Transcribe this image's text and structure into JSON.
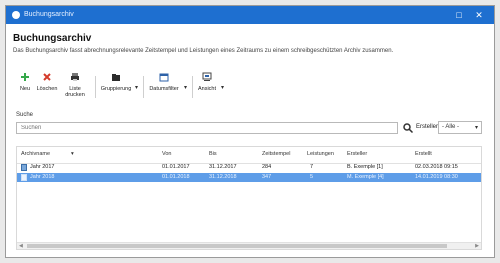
{
  "window": {
    "title": "Buchungsarchiv"
  },
  "header": {
    "title": "Buchungsarchiv",
    "description": "Das Buchungsarchiv fasst abrechnungsrelevante Zeitstempel und Leistungen eines Zeitraums zu einem schreibgeschützten Archiv zusammen."
  },
  "toolbar": {
    "new_label": "Neu",
    "delete_label": "Löschen",
    "print_label": "Liste drucken",
    "group_label": "Gruppierung",
    "datefilter_label": "Datumsfilter",
    "view_label": "Ansicht"
  },
  "search": {
    "label": "Suche",
    "placeholder": "Suchen",
    "filter_label": "Ersteller",
    "filter_value": "- Alle -"
  },
  "table": {
    "columns": [
      "Archivname",
      "Von",
      "Bis",
      "Zeitstempel",
      "Leistungen",
      "Ersteller",
      "Erstellt"
    ],
    "rows": [
      [
        "Jahr 2017",
        "01.01.2017",
        "31.12.2017",
        "284",
        "7",
        "B. Exemple [1]",
        "02.03.2018 09:15"
      ],
      [
        "Jahr 2018",
        "01.01.2018",
        "31.12.2018",
        "347",
        "5",
        "M. Exemple [4]",
        "14.01.2019 08:30"
      ]
    ],
    "selected_row": 1
  },
  "colors": {
    "titlebar": "#1e6fd0",
    "selection": "#5e9de8"
  },
  "icons": {
    "new": "plus-icon",
    "delete": "x-icon",
    "print": "printer-icon",
    "group": "folder-icon",
    "datefilter": "calendar-icon",
    "view": "view-icon",
    "search": "search-icon",
    "row": "document-icon"
  }
}
